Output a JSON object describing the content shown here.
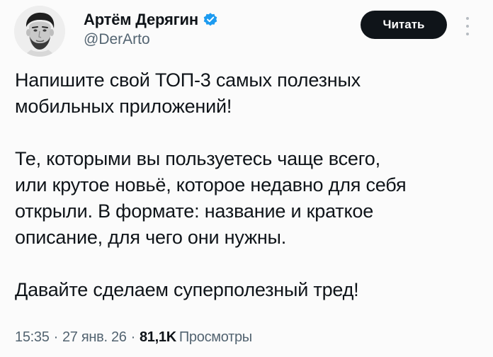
{
  "author": {
    "display_name": "Артём Дерягин",
    "handle": "@DerArto",
    "verified_icon": "verified-badge-icon",
    "verified_color": "#1d9bf0"
  },
  "actions": {
    "follow_label": "Читать",
    "more_icon": "more-vertical-icon"
  },
  "tweet": {
    "paragraphs": [
      "Напишите свой ТОП-3 самых полезных\nмобильных приложений!",
      "Те, которыми вы пользуетесь чаще всего,\nили крутое новьё, которое недавно для себя\nоткрыли. В формате: название и краткое\nописание, для чего они нужны.",
      "Давайте сделаем суперполезный тред!"
    ]
  },
  "meta": {
    "time": "15:35",
    "date": "27 янв. 26",
    "separator": "·",
    "views_count": "81,1K",
    "views_label": "Просмотры"
  }
}
